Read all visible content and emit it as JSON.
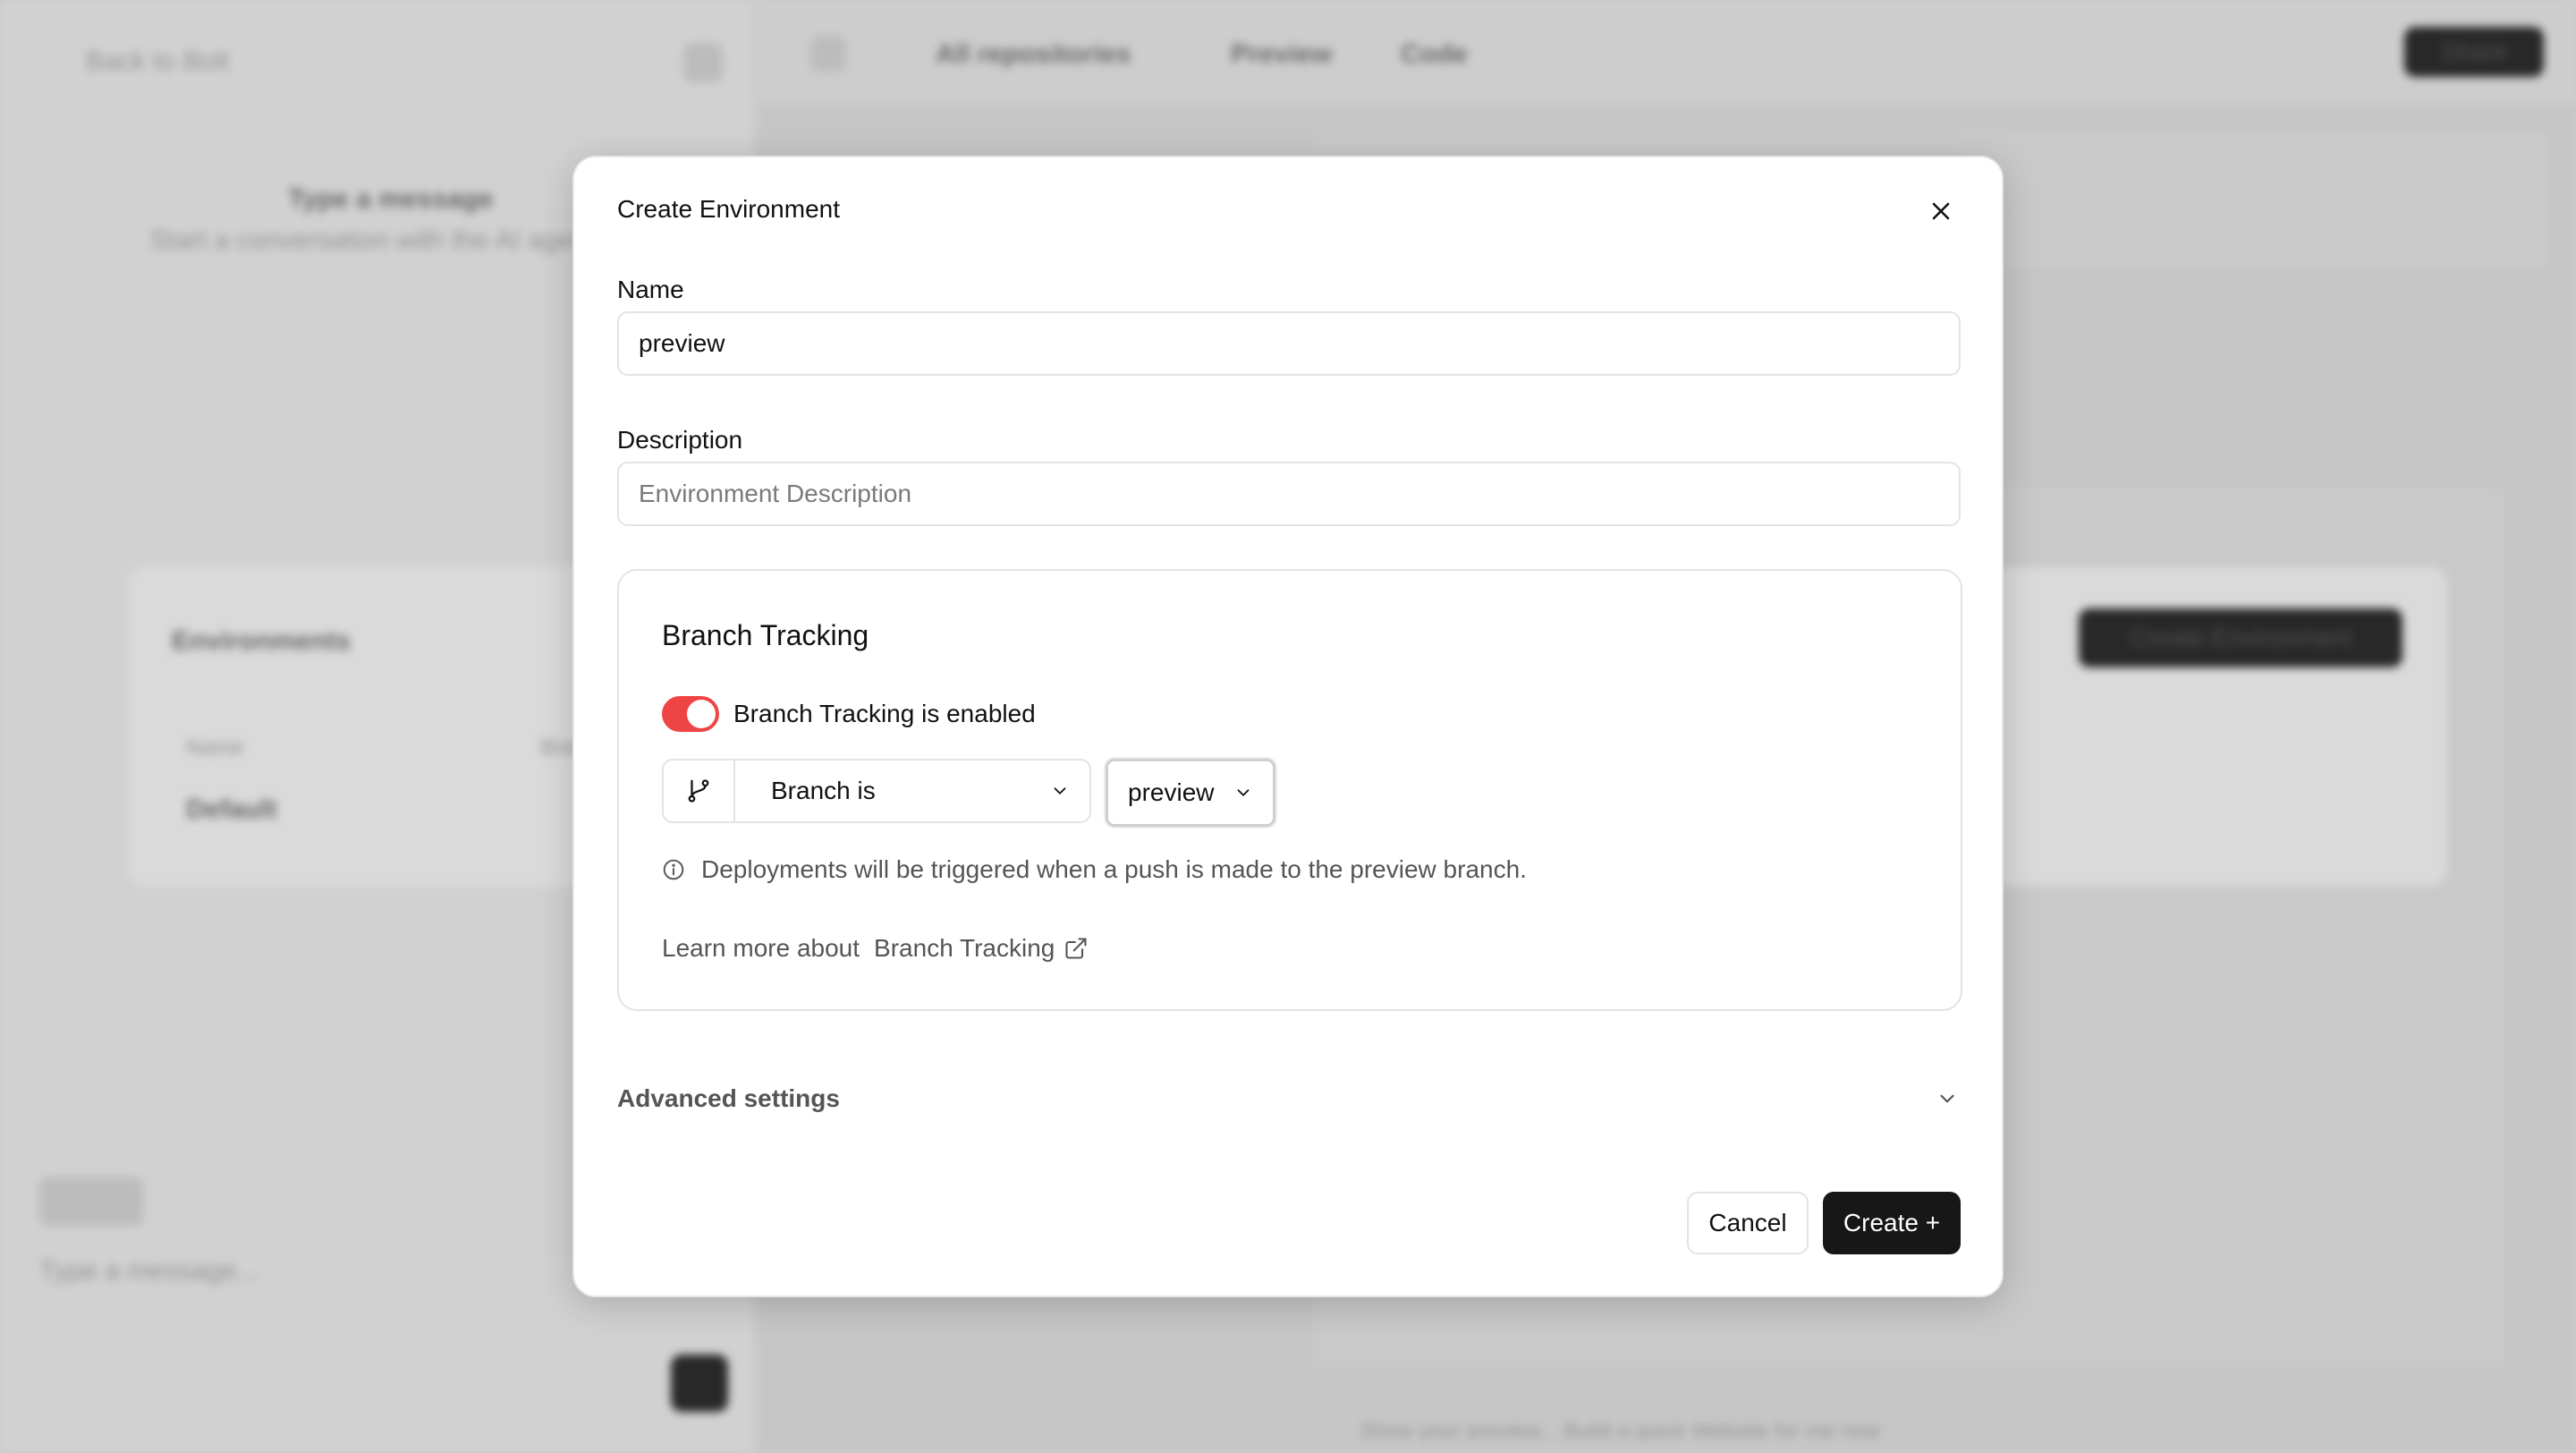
{
  "background": {
    "back_link": "Back to Bolt",
    "chat_heading": "Type a message",
    "chat_subtext": "Start a conversation with the AI agent",
    "repo_label": "All repositories",
    "tab_preview": "Preview",
    "tab_code": "Code",
    "share_button": "Share",
    "environments_title": "Environments",
    "create_environment_button": "Create Environment",
    "table_col_name": "Name",
    "table_col_branch": "Branch",
    "table_row_default": "Default",
    "chat_input_placeholder": "Type a message...",
    "footer_hint": "Show your preview... Build a quick Website for me now"
  },
  "modal": {
    "title": "Create Environment",
    "name_label": "Name",
    "name_value": "preview",
    "description_label": "Description",
    "description_placeholder": "Environment Description",
    "branch_tracking": {
      "title": "Branch Tracking",
      "toggle_label": "Branch Tracking is enabled",
      "toggle_on": true,
      "condition": "Branch is",
      "branch_value": "preview",
      "info_text": "Deployments will be triggered when a push is made to the preview branch.",
      "learn_prefix": "Learn more about",
      "learn_link": "Branch Tracking"
    },
    "advanced_label": "Advanced settings",
    "cancel_label": "Cancel",
    "create_label": "Create +"
  },
  "colors": {
    "toggle_on": "#ef4444",
    "primary_button": "#171717"
  }
}
